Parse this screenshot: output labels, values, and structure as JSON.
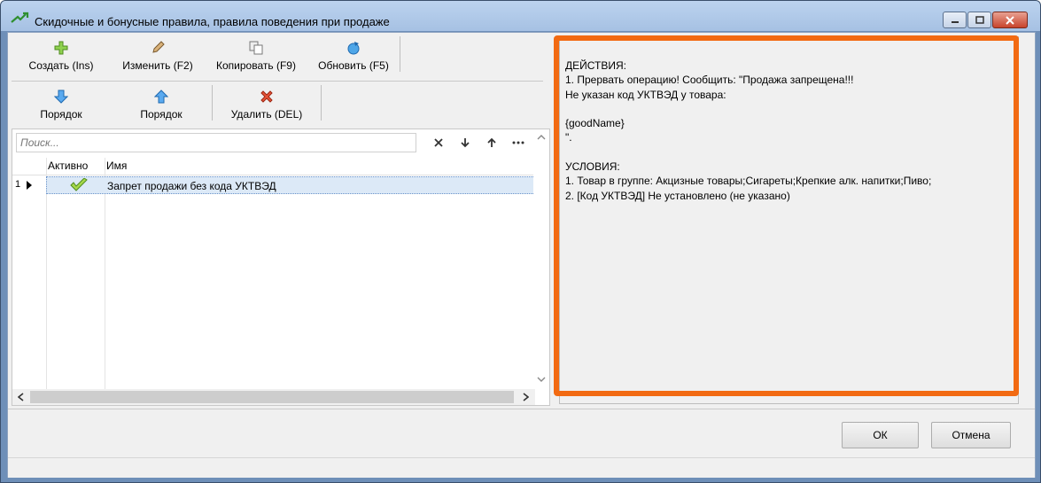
{
  "window": {
    "title": "Скидочные и бонусные правила, правила поведения при продаже"
  },
  "toolbar": {
    "row1": [
      {
        "label": "Создать (Ins)",
        "icon": "plus-icon"
      },
      {
        "label": "Изменить (F2)",
        "icon": "pencil-icon"
      },
      {
        "label": "Копировать (F9)",
        "icon": "copy-icon"
      },
      {
        "label": "Обновить (F5)",
        "icon": "refresh-icon"
      }
    ],
    "row2": [
      {
        "label": "Порядок",
        "icon": "arrow-down-icon"
      },
      {
        "label": "Порядок",
        "icon": "arrow-up-icon"
      },
      {
        "label": "Удалить (DEL)",
        "icon": "delete-icon"
      }
    ]
  },
  "search": {
    "placeholder": "Поиск..."
  },
  "grid": {
    "columns": [
      "Активно",
      "Имя"
    ],
    "rows": [
      {
        "num": "1",
        "active": true,
        "name": "Запрет продажи без кода УКТВЭД"
      }
    ]
  },
  "details": {
    "text": "ДЕЙСТВИЯ:\n1. Прервать операцию! Сообщить: \"Продажа запрещена!!!\nНе указан код УКТВЭД у товара:\n\n{goodName}\n\".\n\nУСЛОВИЯ:\n1. Товар в группе: Акцизные товары;Сигареты;Крепкие алк. напитки;Пиво;\n2. [Код УКТВЭД] Не установлено (не указано)"
  },
  "dialog": {
    "ok_label": "ОК",
    "cancel_label": "Отмена"
  },
  "colors": {
    "highlight": "#f26a12",
    "selected_row": "#dce9f7"
  }
}
